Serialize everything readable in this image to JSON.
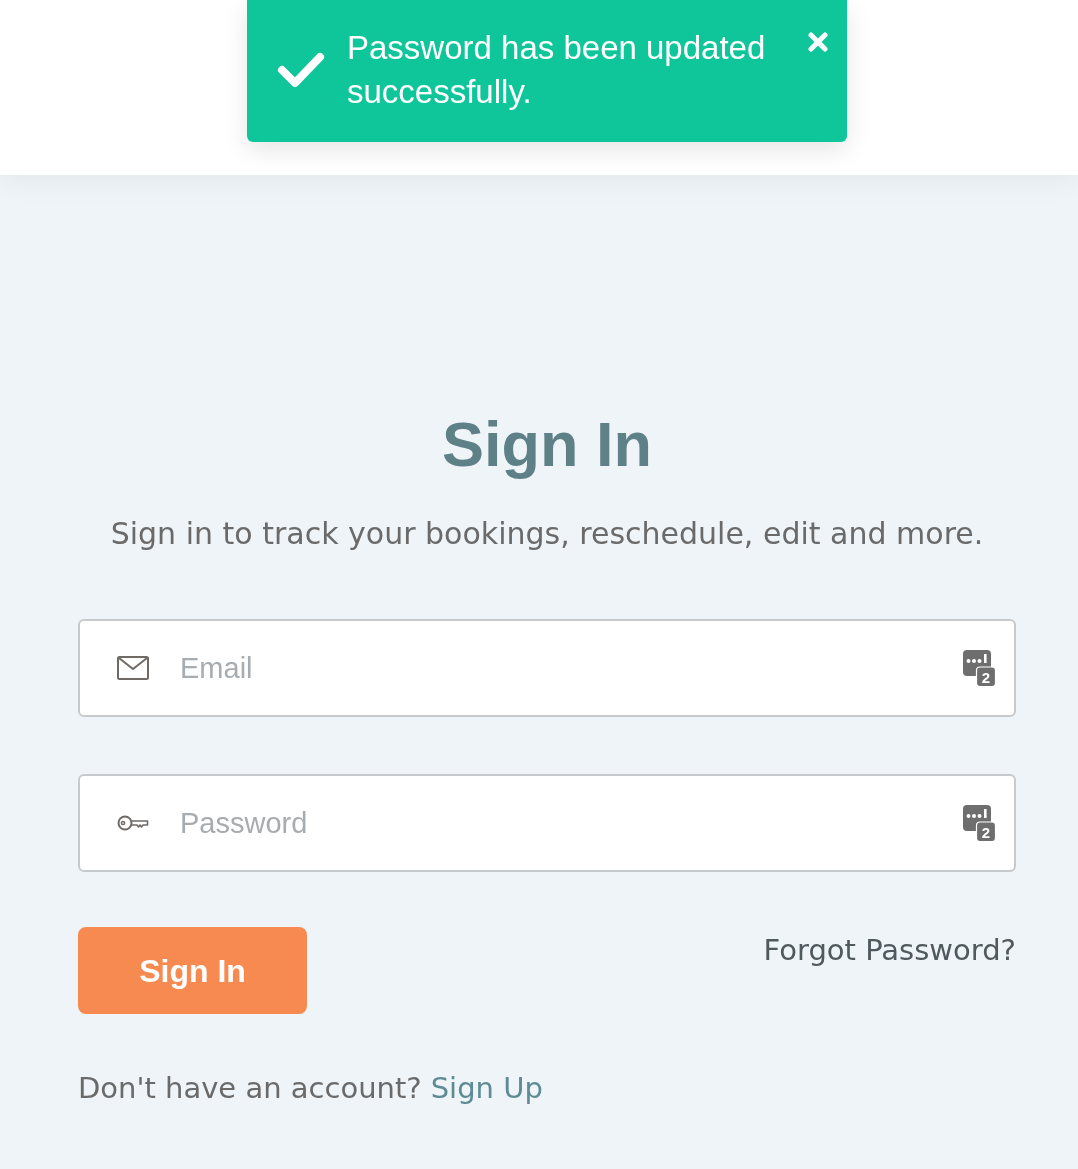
{
  "toast": {
    "kind": "success",
    "message": "Password has been updated successfully."
  },
  "title": "Sign In",
  "subtitle": "Sign in to track your bookings, reschedule, edit and more.",
  "fields": [
    {
      "kind": "email",
      "placeholder": "Email",
      "manager_badge": "2"
    },
    {
      "kind": "password",
      "placeholder": "Password",
      "manager_badge": "2"
    }
  ],
  "submit_button": "Sign In",
  "forgot_link": "Forgot Password?",
  "signup": {
    "prompt": "Don't have an account?",
    "link": "Sign Up"
  }
}
